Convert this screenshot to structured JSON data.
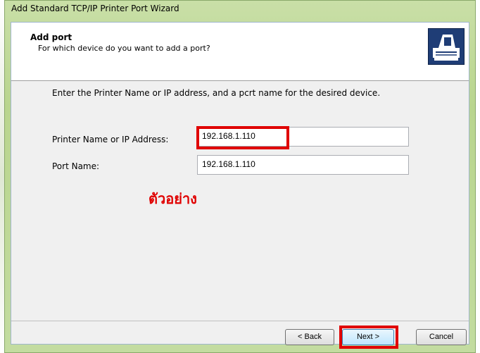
{
  "window": {
    "title": "Add Standard TCP/IP Printer Port Wizard"
  },
  "header": {
    "title": "Add port",
    "subtitle": "For which device do you want to add a port?",
    "icon": "printer-port-icon"
  },
  "main": {
    "instruction": "Enter the Printer Name or IP address, and a pcrt name for the desired device.",
    "fields": {
      "printer_name": {
        "label": "Printer Name or IP Address:",
        "value": "192.168.1.110"
      },
      "port_name": {
        "label": "Port Name:",
        "value": "192.168.1.110"
      }
    },
    "annotation": "ตัวอย่าง",
    "annotation_color": "#e00000"
  },
  "buttons": {
    "back": "< Back",
    "next": "Next >",
    "cancel": "Cancel"
  }
}
